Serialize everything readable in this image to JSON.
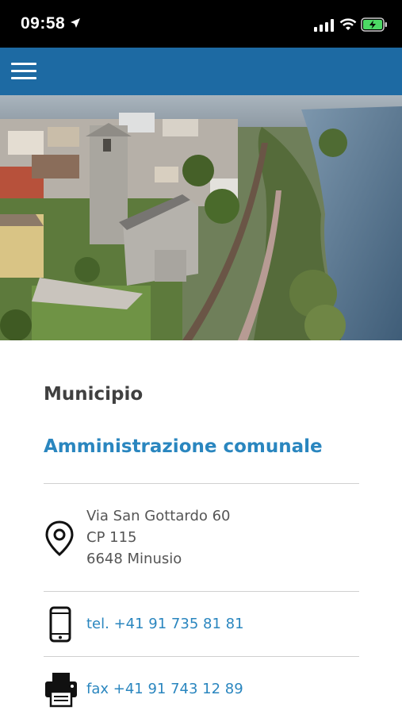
{
  "status": {
    "time": "09:58"
  },
  "header": {
    "menu_icon": "hamburger-menu-icon",
    "bar_color": "#1d6aa3"
  },
  "hero": {
    "alt": "Aerial view of Minusio lakeside with church tower"
  },
  "main": {
    "section": "Municipio",
    "organization": "Amministrazione comunale",
    "address": {
      "icon": "location-pin-icon",
      "line1": "Via San Gottardo 60",
      "line2": "CP 115",
      "line3": "6648 Minusio"
    },
    "phone": {
      "icon": "mobile-phone-icon",
      "label": "tel. +41 91 735 81 81"
    },
    "fax": {
      "icon": "fax-icon",
      "label": "fax +41 91 743 12 89"
    }
  },
  "colors": {
    "accent": "#2a86bf",
    "heading": "#404040",
    "text": "#555555"
  }
}
